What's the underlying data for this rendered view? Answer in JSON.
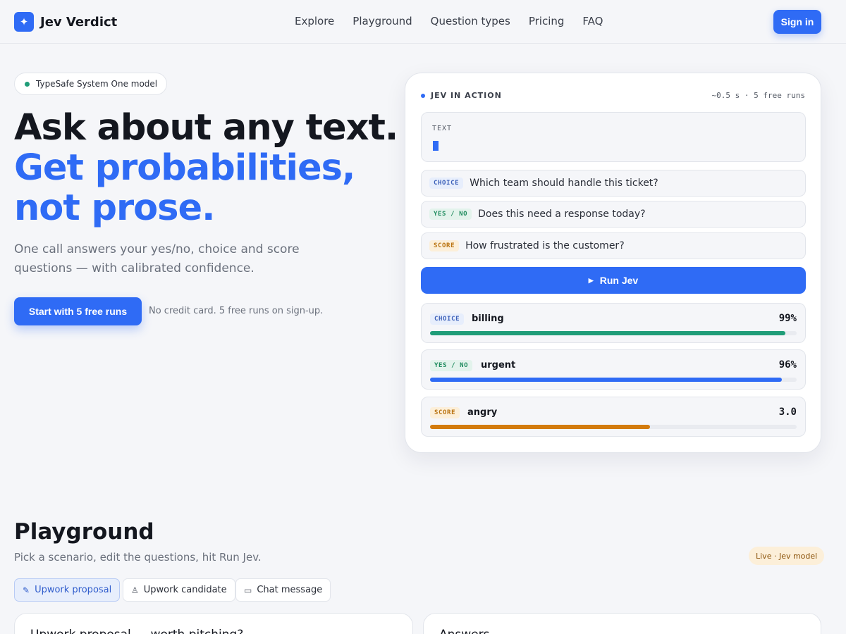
{
  "header": {
    "logo_glyph": "✦",
    "brand": "Jev Verdict",
    "nav": [
      "Explore",
      "Playground",
      "Question types",
      "Pricing",
      "FAQ"
    ],
    "signin_label": "Sign in"
  },
  "hero": {
    "pill_text": "TypeSafe System One model",
    "headline_1": "Ask about any text.",
    "headline_2": "Get probabilities,",
    "headline_3": "not prose.",
    "lede": "One call answers your yes/no, choice and score questions — with calibrated confidence.",
    "cta_label": "Start with 5 free runs",
    "cta_note": "No credit card. 5 free runs on sign-up."
  },
  "demo": {
    "label": "JEV IN ACTION",
    "meta": "~0.5 s · 5 free runs",
    "text_label": "TEXT",
    "text_value": "",
    "questions": [
      {
        "tag": "CHOICE",
        "text": "Which team should handle this ticket?"
      },
      {
        "tag": "YES / NO",
        "text": "Does this need a response today?"
      },
      {
        "tag": "SCORE",
        "text": "How frustrated is the customer?"
      }
    ],
    "run_icon": "▶",
    "run_label": "Run Jev",
    "results": [
      {
        "tag": "CHOICE",
        "label": "billing",
        "value": "99%",
        "fraction": 0.97
      },
      {
        "tag": "YES / NO",
        "label": "urgent",
        "value": "96%",
        "fraction": 0.96
      },
      {
        "tag": "SCORE",
        "label": "angry",
        "value": "3.0",
        "fraction": 0.6
      }
    ]
  },
  "playground": {
    "title": "Playground",
    "subtitle": "Pick a scenario, edit the questions, hit Run Jev.",
    "live_badge": "Live · Jev model",
    "tabs": [
      {
        "icon": "✎",
        "label": "Upwork proposal"
      },
      {
        "icon": "♙",
        "label": "Upwork candidate"
      },
      {
        "icon": "▭",
        "label": "Chat message"
      }
    ],
    "left_panel_title": "Upwork proposal — worth pitching?",
    "right_panel_title": "Answers"
  },
  "colors": {
    "accent": "#2f6bf5",
    "green": "#1f9d78",
    "orange": "#d37b0d",
    "status_dot": "#1f9d78"
  }
}
